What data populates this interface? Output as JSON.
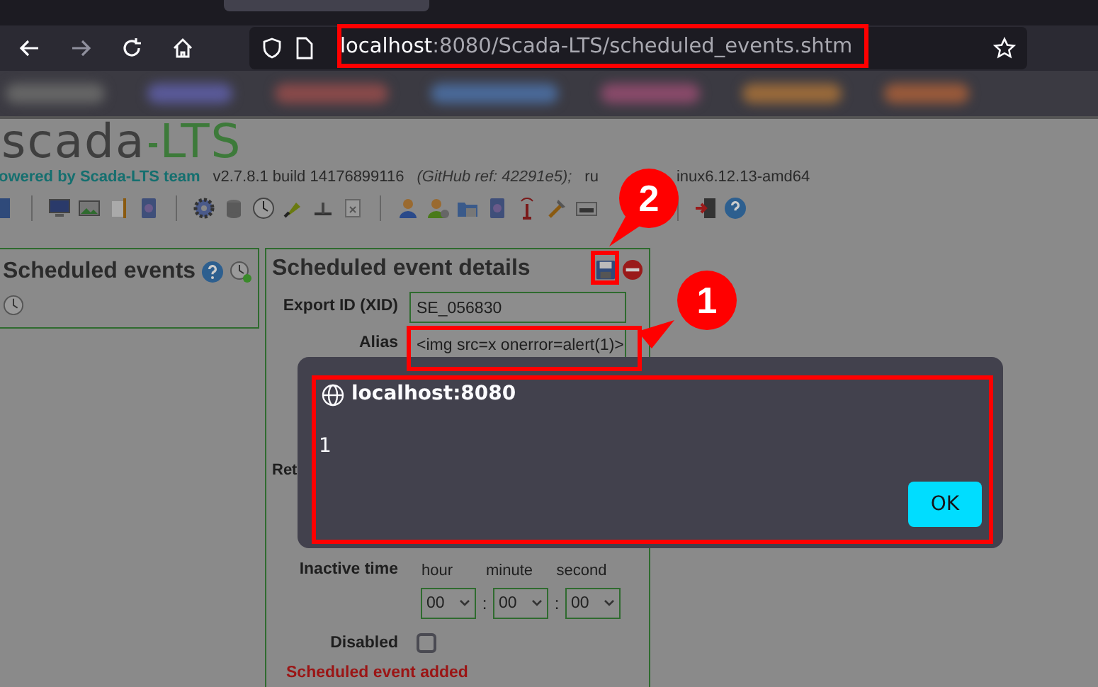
{
  "browser": {
    "url_host": "localhost",
    "url_rest": ":8080/Scada-LTS/scheduled_events.shtm"
  },
  "header": {
    "logo_main": "scada",
    "logo_accent": "LTS",
    "powered": "owered by Scada-LTS team",
    "version": "v2.7.8.1 build 14176899116",
    "github": "(GitHub ref: 42291e5);",
    "runtime_start": "ru",
    "runtime_end": "inux6.12.13-amd64"
  },
  "list_panel": {
    "title": "Scheduled events"
  },
  "details": {
    "title": "Scheduled event details",
    "fields": [
      {
        "label": "Export ID (XID)",
        "value": "SE_056830"
      },
      {
        "label": "Alias",
        "value": "<img src=x onerror=alert(1)>"
      }
    ],
    "partial_labels": [
      "Ret"
    ],
    "inactive": {
      "label": "Inactive time",
      "units": [
        "hour",
        "minute",
        "second"
      ],
      "values": [
        "00",
        "00",
        "00"
      ],
      "separator": ":"
    },
    "disabled": {
      "label": "Disabled",
      "checked": false
    },
    "message": "Scheduled event added"
  },
  "dialog": {
    "origin": "localhost:8080",
    "message": "1",
    "button": "OK"
  },
  "callouts": [
    {
      "number": "1"
    },
    {
      "number": "2"
    }
  ]
}
